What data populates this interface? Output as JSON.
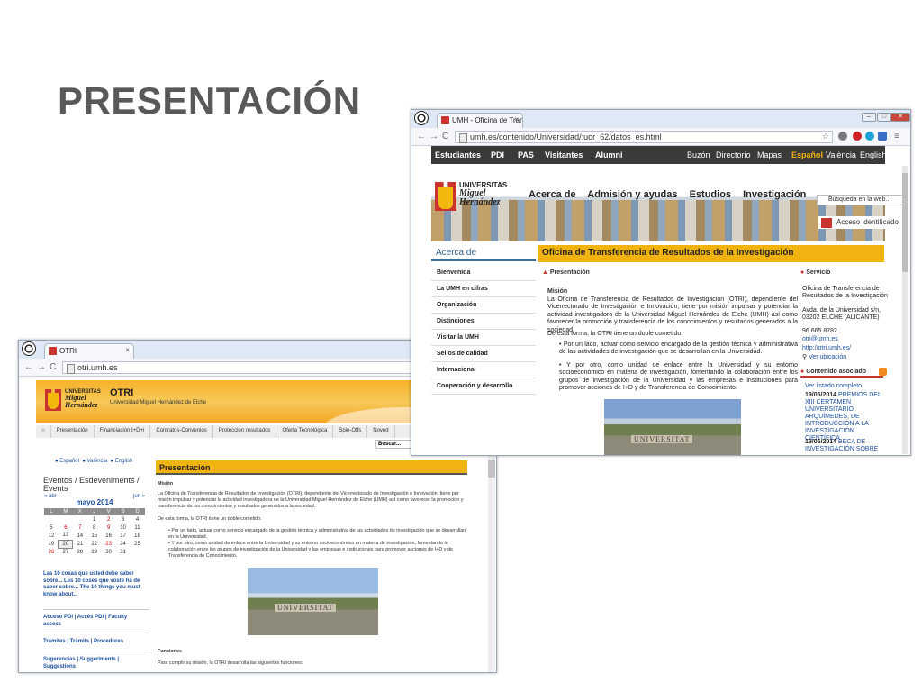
{
  "slide": {
    "title": "PRESENTACIÓN"
  },
  "umh_window": {
    "tab_title": "UMH - Oficina de Transfe",
    "url": "umh.es/contenido/Universidad/:uor_62/datos_es.html",
    "topbar_left": [
      "Estudiantes",
      "PDI",
      "PAS",
      "Visitantes",
      "Alumni"
    ],
    "topbar_right": [
      "Buzón",
      "Directorio",
      "Mapas",
      "Español",
      "València",
      "English"
    ],
    "logo_line1": "UNIVERSITAS",
    "logo_line2": "Miguel",
    "logo_line3": "Hernández",
    "main_nav": [
      "Acerca de",
      "Admisión y ayudas",
      "Estudios",
      "Investigación"
    ],
    "search_placeholder": "Búsqueda en la web...",
    "access_label": "Acceso identificado",
    "side_heading": "Acerca de",
    "side_menu": [
      "Bienvenida",
      "La UMH en cifras",
      "Organización",
      "Distinciones",
      "Visitar la UMH",
      "Sellos de calidad",
      "Internacional",
      "Cooperación y desarrollo"
    ],
    "content_title": "Oficina de Transferencia de Resultados de la Investigación",
    "section_presentacion": "Presentación",
    "mision_heading": "Misión",
    "mision_p1": "La Oficina de Transferencia de Resultados de Investigación (OTRI), dependiente del Vicerrectorado de Investigación e Innovación, tiene por misión impulsar y potenciar la actividad investigadora de la Universidad Miguel Hernández de Elche (UMH) así como favorecer la promoción y transferencia de los conocimientos y resultados generados a la sociedad.",
    "mision_p2": "De esta forma, la OTRI tiene un doble cometido:",
    "bullet1": "Por un lado, actuar como servicio encargado de la gestión técnica y administrativa de las actividades de investigación que se desarrollan en la Universidad.",
    "bullet2": "Y por otro, como unidad de enlace entre la Universidad y su entorno socioeconómico en materia de investigación, fomentando la colaboración entre los grupos de investigación de la Universidad y las empresas e instituciones para promover acciones de I+D y de Transferencia de Conocimiento.",
    "photo_caption": "UNIVERSITAT",
    "servicio_heading": "Servicio",
    "servicio_name": "Oficina de Transferencia de Resultados de la Investigación",
    "servicio_address": "Avda. de la Universidad s/n, 03202 ELCHE (ALICANTE)",
    "servicio_phone": "96 665 8782",
    "servicio_email": "otri@umh.es",
    "servicio_web": "http://otri.umh.es/",
    "servicio_location": "Ver ubicación",
    "related_heading": "Contenido asociado",
    "related_all": "Ver listado completo",
    "related1_date": "19/05/2014",
    "related1_text": "PREMIOS DEL XIII CERTAMEN UNIVERSITARIO ARQUÍMEDES, DE INTRODUCCIÓN A LA INVESTIGACIÓN CIENTÍFICA",
    "related2_date": "19/05/2014",
    "related2_text": "BECA DE INVESTIGACIÓN SOBRE"
  },
  "otri_window": {
    "tab_title": "OTRI",
    "url": "otri.umh.es",
    "logo_line1": "UNIVERSITAS",
    "logo_line2": "Miguel",
    "logo_line3": "Hernández",
    "site_name": "OTRI",
    "site_subtitle": "Universidad Miguel Hernández de Elche",
    "tabs": [
      "Presentación",
      "Financiación I+D+i",
      "Contratos-Convenios",
      "Protección resultados",
      "Oferta Tecnológica",
      "Spin-Offs",
      "Noved"
    ],
    "search_label": "Buscar...",
    "languages": [
      "Español",
      "València",
      "English"
    ],
    "events_title": "Eventos / Esdeveniments / Events",
    "cal_prev": "« abr",
    "cal_next": "jun »",
    "cal_month": "mayo 2014",
    "cal_days": [
      "L",
      "M",
      "X",
      "J",
      "V",
      "S",
      "D"
    ],
    "cal_weeks": [
      [
        "",
        "",
        "",
        "1",
        "2",
        "3",
        "4"
      ],
      [
        "5",
        "6",
        "7",
        "8",
        "9",
        "10",
        "11"
      ],
      [
        "12",
        "13",
        "14",
        "15",
        "16",
        "17",
        "18"
      ],
      [
        "19",
        "20",
        "21",
        "22",
        "23",
        "24",
        "25"
      ],
      [
        "26",
        "27",
        "28",
        "29",
        "30",
        "31",
        ""
      ]
    ],
    "links1": "Las 10 cosas que usted debe saber sobre... Les 10 coses que vostè ha de saber sobre... The 10 things you must know about...",
    "links2": "Acceso PDI | Accés PDI | Faculty access",
    "links3": "Trámites | Tràmits | Procedures",
    "links4": "Sugerencias | Suggeriments | Suggestions",
    "content_title": "Presentación",
    "mision_heading": "Misión",
    "mision_p1": "La Oficina de Transferencia de Resultados de Investigación (OTRI), dependiente del Vicerrectorado de Investigación e Innovación, tiene por misión impulsar y potenciar la actividad investigadora de la Universidad Miguel Hernández de Elche (UMH) así como favorecer la promoción y transferencia de los conocimientos y resultados generados a la sociedad.",
    "mision_p2": "De esta forma, la OTRI tiene un doble cometido:",
    "bullet1": "• Por un lado, actuar como servicio encargado de la gestión técnica y administrativa de las actividades de investigación que se desarrollan en la Universidad.",
    "bullet2": "• Y por otro, como unidad de enlace entre la Universidad y su entorno socioeconómico en materia de investigación, fomentando la colaboración entre los grupos de investigación de la Universidad y las empresas e instituciones para promover acciones de I+D y de Transferencia de Conocimiento.",
    "photo_caption": "UNIVERSITAT",
    "funciones_heading": "Funciones",
    "funciones_text": "Para cumplir su misión, la OTRI desarrolla las siguientes funciones:"
  }
}
